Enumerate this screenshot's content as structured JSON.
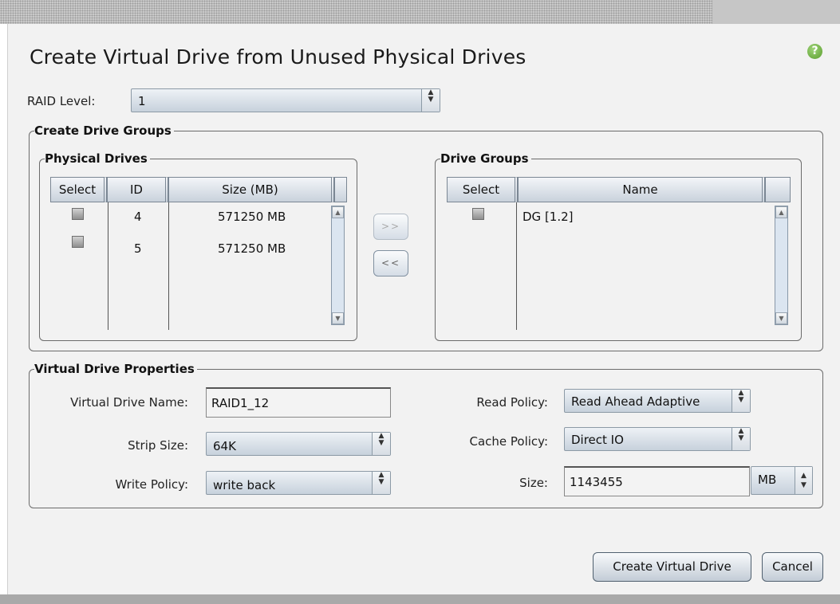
{
  "dialog": {
    "title": "Create Virtual Drive from Unused Physical Drives",
    "help_icon": "?"
  },
  "raid_level": {
    "label": "RAID Level:",
    "value": "1"
  },
  "create_drive_groups": {
    "legend": "Create Drive Groups",
    "physical_drives": {
      "legend": "Physical Drives",
      "columns": [
        "Select",
        "ID",
        "Size (MB)"
      ],
      "rows": [
        {
          "id": "4",
          "size": "571250 MB"
        },
        {
          "id": "5",
          "size": "571250 MB"
        }
      ]
    },
    "add_button": ">>",
    "remove_button": "<<",
    "drive_groups": {
      "legend": "Drive Groups",
      "columns": [
        "Select",
        "Name"
      ],
      "rows": [
        {
          "name": "DG [1.2]"
        }
      ]
    }
  },
  "vd_props": {
    "legend": "Virtual Drive Properties",
    "name_label": "Virtual Drive Name:",
    "name_value": "RAID1_12",
    "strip_label": "Strip Size:",
    "strip_value": "64K",
    "write_label": "Write Policy:",
    "write_value": "write back",
    "read_label": "Read Policy:",
    "read_value": "Read Ahead Adaptive",
    "cache_label": "Cache Policy:",
    "cache_value": "Direct IO",
    "size_label": "Size:",
    "size_value": "1143455",
    "size_unit": "MB"
  },
  "buttons": {
    "create": "Create Virtual Drive",
    "cancel": "Cancel"
  }
}
